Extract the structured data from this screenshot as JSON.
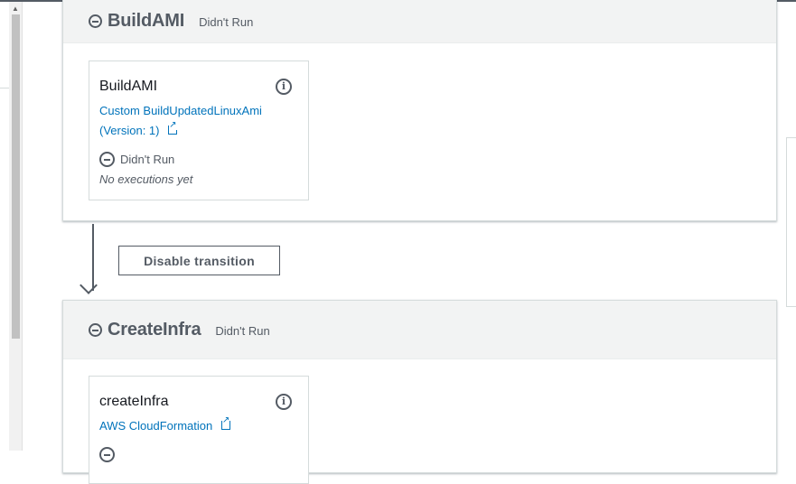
{
  "stages": [
    {
      "title": "BuildAMI",
      "status": "Didn't Run",
      "action": {
        "name": "BuildAMI",
        "provider_line1": "Custom BuildUpdatedLinuxAmi",
        "provider_line2": "(Version: 1)",
        "status": "Didn't Run",
        "detail": "No executions yet"
      }
    },
    {
      "title": "CreateInfra",
      "status": "Didn't Run",
      "action": {
        "name": "createInfra",
        "provider_line1": "AWS CloudFormation"
      }
    }
  ],
  "transition": {
    "button_label": "Disable transition"
  },
  "icons": {
    "stage_status": "minus-circle-icon",
    "info": "info-circle-icon",
    "external_link": "external-link-icon"
  },
  "colors": {
    "link": "#0073bb",
    "text_muted": "#545b64",
    "header_bg": "#f2f3f3"
  }
}
